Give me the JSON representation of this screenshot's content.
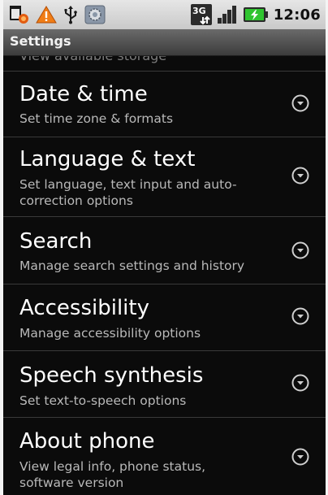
{
  "status_bar": {
    "time": "12:06",
    "network_type": "3G",
    "left_icons": [
      "debug-bug-icon",
      "warning-icon",
      "usb-icon",
      "settings-gear-icon"
    ],
    "right_icons": [
      "network-3g-icon",
      "signal-bars-icon",
      "battery-charging-icon"
    ]
  },
  "title_bar": {
    "title": "Settings"
  },
  "partial_item": {
    "text": "View available storage"
  },
  "items": [
    {
      "title": "Date & time",
      "subtitle": "Set time zone & formats"
    },
    {
      "title": "Language & text",
      "subtitle": "Set language, text input and auto-correction options"
    },
    {
      "title": "Search",
      "subtitle": "Manage search settings and history"
    },
    {
      "title": "Accessibility",
      "subtitle": "Manage accessibility options"
    },
    {
      "title": "Speech synthesis",
      "subtitle": "Set text-to-speech options"
    },
    {
      "title": "About phone",
      "subtitle": "View legal info, phone status, software version"
    }
  ],
  "colors": {
    "background": "#0b0b0b",
    "title_text": "#ffffff",
    "subtitle_text": "#b9b9b9",
    "divider": "#3a3a3a",
    "status_bar": "#d6d6d6",
    "battery_charge": "#2fc42f"
  }
}
